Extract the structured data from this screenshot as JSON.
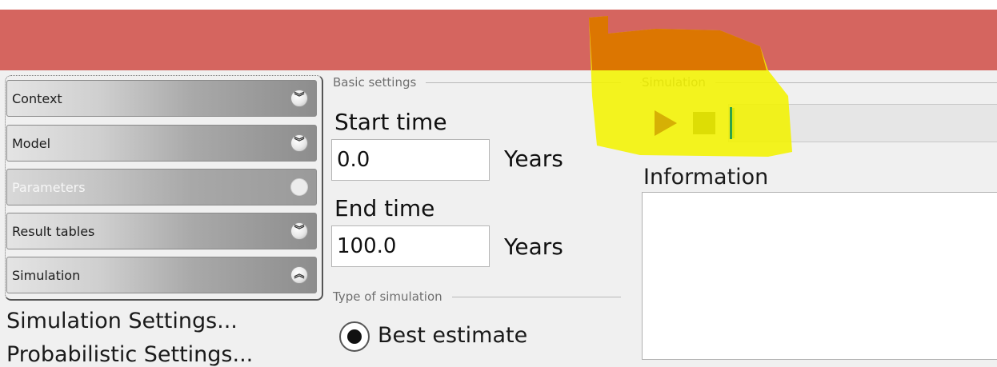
{
  "accordion": {
    "items": [
      {
        "label": "Context",
        "chevron": "double-chevron-down-icon",
        "state": "normal"
      },
      {
        "label": "Model",
        "chevron": "double-chevron-down-icon",
        "state": "normal"
      },
      {
        "label": "Parameters",
        "chevron": "circle-icon",
        "state": "disabled"
      },
      {
        "label": "Result tables",
        "chevron": "double-chevron-down-icon",
        "state": "normal"
      },
      {
        "label": "Simulation",
        "chevron": "double-chevron-up-icon",
        "state": "expanded"
      }
    ]
  },
  "left_menu": {
    "simulation_settings": "Simulation Settings...",
    "probabilistic_settings": "Probabilistic Settings..."
  },
  "basic_settings": {
    "title": "Basic settings",
    "start_time_label": "Start time",
    "start_time_value": "0.0",
    "start_time_unit": "Years",
    "end_time_label": "End time",
    "end_time_value": "100.0",
    "end_time_unit": "Years"
  },
  "type_of_simulation": {
    "title": "Type of simulation",
    "selected_option": "Best estimate"
  },
  "simulation": {
    "title": "Simulation",
    "progress": 0.0
  },
  "information": {
    "label": "Information",
    "content": ""
  },
  "colors": {
    "header_band": "#d5655f",
    "highlight_yellow": "#f2f200",
    "highlight_orange": "#d96a00",
    "progress_marker": "#2ea34a"
  }
}
